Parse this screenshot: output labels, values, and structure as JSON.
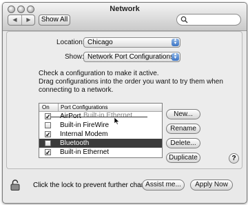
{
  "window": {
    "title": "Network"
  },
  "toolbar": {
    "back_icon": "◀",
    "forward_icon": "▶",
    "show_all_label": "Show All",
    "search_placeholder": ""
  },
  "location": {
    "label": "Location:",
    "value": "Chicago"
  },
  "show": {
    "label": "Show:",
    "value": "Network Port Configurations"
  },
  "instructions": {
    "line1": "Check a configuration to make it active.",
    "line2": "Drag configurations into the order you want to try them when",
    "line3": "connecting to a network."
  },
  "table": {
    "headers": {
      "on": "On",
      "name": "Port Configurations"
    },
    "rows": [
      {
        "name": "AirPort",
        "checked": true,
        "selected": false
      },
      {
        "name": "Built-in FireWire",
        "checked": false,
        "selected": false
      },
      {
        "name": "Internal Modem",
        "checked": true,
        "selected": false
      },
      {
        "name": "Bluetooth",
        "checked": false,
        "selected": true
      },
      {
        "name": "Built-in Ethernet",
        "checked": true,
        "selected": false
      }
    ],
    "drag_ghost": "Built-in Ethernet"
  },
  "buttons": {
    "new": "New...",
    "rename": "Rename",
    "delete": "Delete...",
    "duplicate": "Duplicate",
    "help": "?"
  },
  "footer": {
    "lock_text": "Click the lock to prevent further changes.",
    "assist": "Assist me...",
    "apply": "Apply Now"
  }
}
